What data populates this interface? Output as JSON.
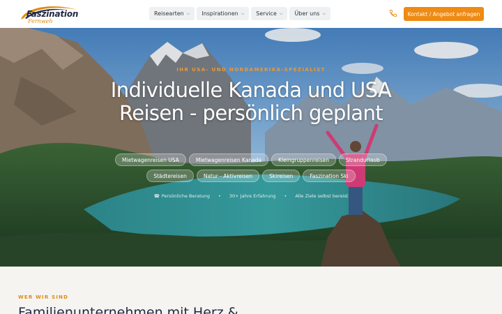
{
  "header": {
    "logo_main": "Faszination",
    "logo_sub": "Fernweh",
    "nav": [
      {
        "label": "Reisearten"
      },
      {
        "label": "Inspirationen"
      },
      {
        "label": "Service"
      },
      {
        "label": "Über uns"
      }
    ],
    "phone_icon": "phone-icon",
    "cta_label": "Kontakt / Angebot anfragen"
  },
  "hero": {
    "eyebrow": "IHR USA- UND NORDAMERIKA-SPEZIALIST",
    "title": "Individuelle Kanada und USA Reisen - persönlich geplant",
    "chips_row1": [
      "Mietwagenreisen USA",
      "Mietwagenreisen Kanada",
      "Kleingruppenreisen",
      "Strandurlaub"
    ],
    "chips_row2": [
      "Städtereisen",
      "Natur - Aktivreisen",
      "Skireisen",
      "Faszination Ski"
    ],
    "features": [
      "Persönliche Beratung",
      "30+ Jahre Erfahrung",
      "Alle Ziele selbst bereist"
    ]
  },
  "section": {
    "eyebrow": "WER WIR SIND",
    "title": "Familienunternehmen mit Herz &"
  },
  "colors": {
    "accent": "#ef8a12",
    "navy": "#1f2a44"
  }
}
